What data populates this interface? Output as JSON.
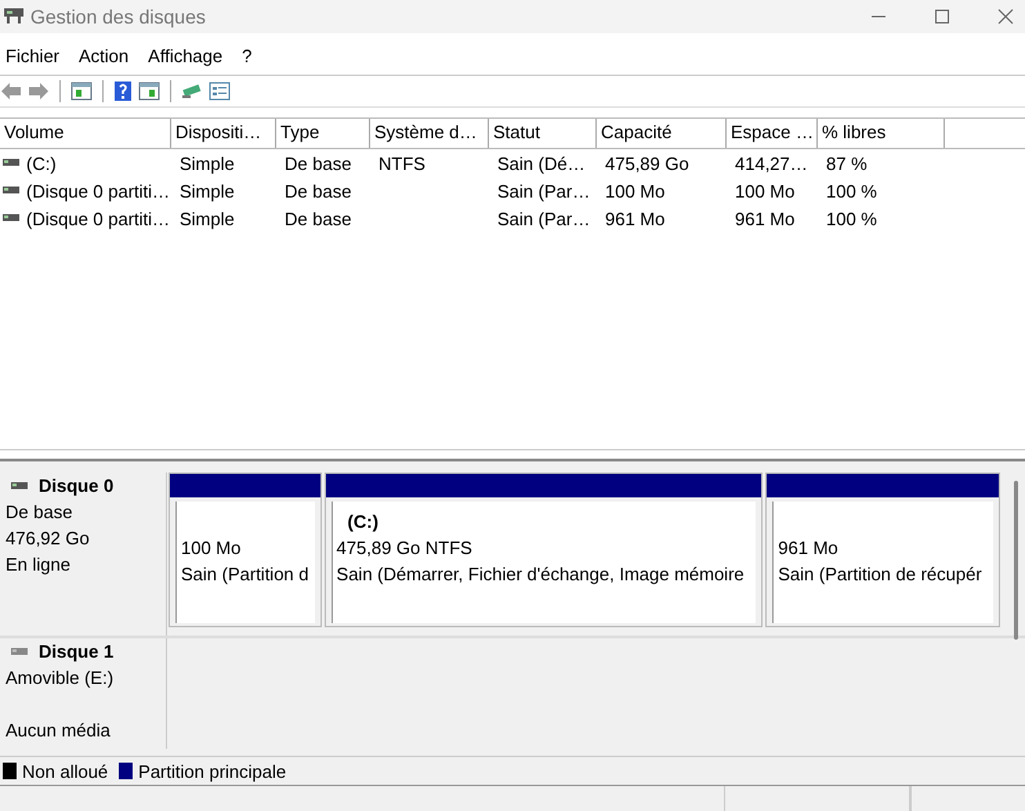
{
  "window": {
    "title": "Gestion des disques"
  },
  "menu": [
    "Fichier",
    "Action",
    "Affichage",
    "?"
  ],
  "table": {
    "columns": [
      "Volume",
      "Dispositi…",
      "Type",
      "Système d…",
      "Statut",
      "Capacité",
      "Espace …",
      "% libres"
    ],
    "rows": [
      [
        "(C:)",
        "Simple",
        "De base",
        "NTFS",
        "Sain (Dé…",
        "475,89 Go",
        "414,27…",
        "87 %"
      ],
      [
        "(Disque 0 partiti…",
        "Simple",
        "De base",
        null,
        "Sain (Par…",
        "100 Mo",
        "100 Mo",
        "100 %"
      ],
      [
        "(Disque 0 partiti…",
        "Simple",
        "De base",
        null,
        "Sain (Par…",
        "961 Mo",
        "961 Mo",
        "100 %"
      ]
    ]
  },
  "disks": [
    {
      "name": "Disque 0",
      "type": "De base",
      "size": "476,92 Go",
      "state": "En ligne",
      "partitions": [
        {
          "size": "100 Mo",
          "status": "Sain (Partition d",
          "color": "#000080"
        },
        {
          "title": "(C:)",
          "size": "475,89 Go NTFS",
          "status": "Sain (Démarrer, Fichier d'échange, Image mémoire",
          "color": "#000080"
        },
        {
          "size": "961 Mo",
          "status": "Sain (Partition de récupér",
          "color": "#000080"
        }
      ]
    },
    {
      "name": "Disque 1",
      "type": "Amovible (E:)",
      "state": "Aucun média"
    }
  ],
  "legend": [
    {
      "label": "Non alloué",
      "color": "#000000"
    },
    {
      "label": "Partition principale",
      "color": "#000080"
    }
  ]
}
